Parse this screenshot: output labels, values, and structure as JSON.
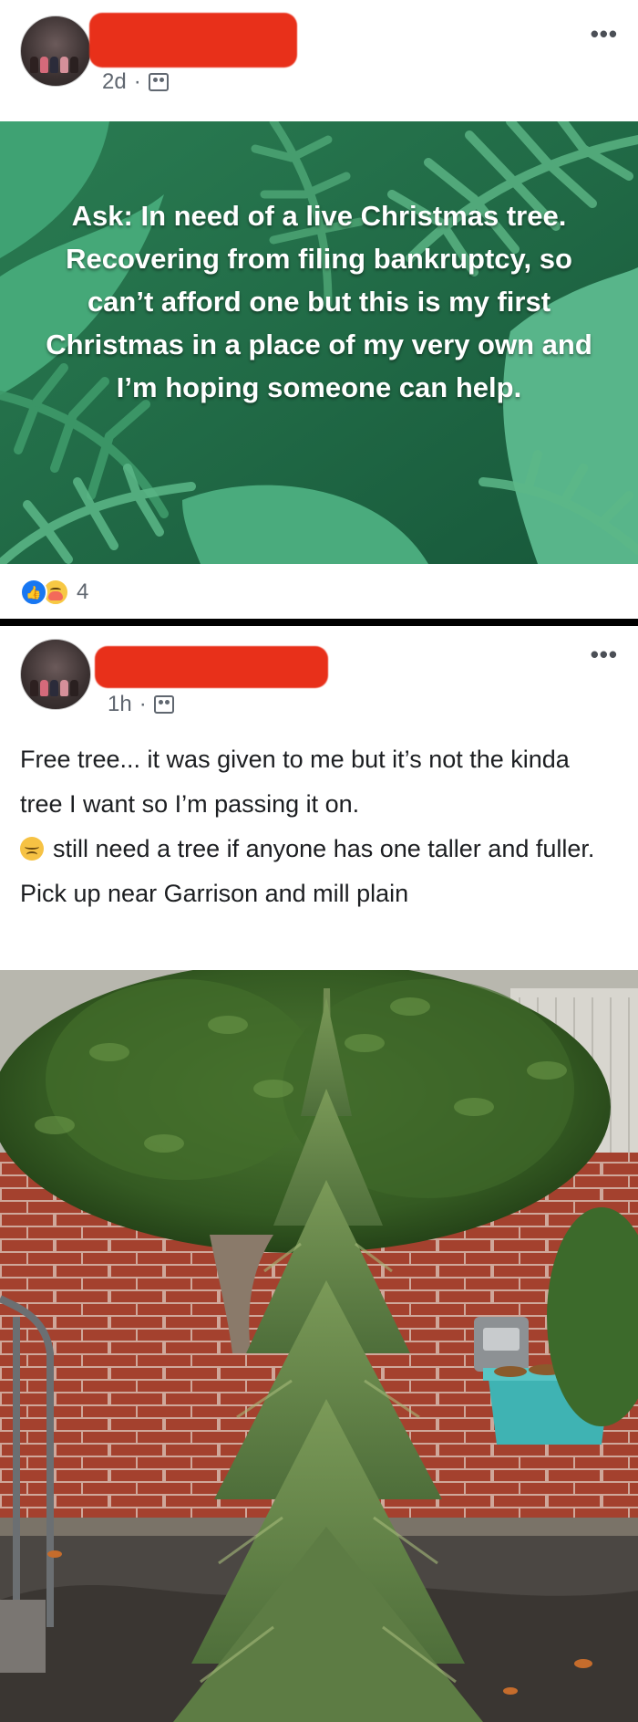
{
  "post1": {
    "time": "2d",
    "dot": "·",
    "more": "•••",
    "text": "Ask: In need of a live Christmas tree. Recovering from filing bankruptcy, so can’t afford one but this is my first Christmas in a place of my very own and I’m hoping someone can help.",
    "reaction_count": "4",
    "background_color": "#1f6a45"
  },
  "post2": {
    "time": "1h",
    "dot": "·",
    "more": "•••",
    "text_line1": "Free tree... it was given to me but it’s not the kinda tree I want so I’m passing it on.",
    "text_line2": "still need a tree if anyone has one taller and fuller. Pick up near Garrison and mill plain"
  },
  "colors": {
    "redaction": "#e8301a",
    "divider": "#000000",
    "like_blue": "#1877f2"
  }
}
